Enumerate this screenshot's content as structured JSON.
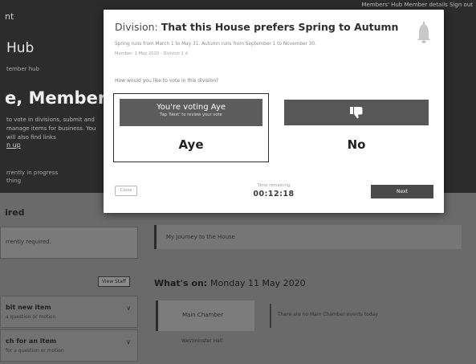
{
  "background": {
    "topbar_label": "nt",
    "topnav_text": "Members' Hub   Member details   Sign out",
    "hub_title": "Hub",
    "hub_sub": "tember hub",
    "welcome_title": "e, Member of P",
    "welcome_desc": "to vote in divisions, submit and manage items for business. You will also find links",
    "signup_link": "n up",
    "progress_text": "rrently in progress\nthing",
    "required_heading": "ired",
    "required_card_text": "rrently required.",
    "view_all_label": "View Staff",
    "list_items": [
      {
        "title": "bit new item",
        "sub": "a question or motion"
      },
      {
        "title": "ch for an item",
        "sub": "for a question or motion"
      }
    ],
    "journey_text": "My Journey to the House",
    "whatson_prefix": "What's on:",
    "whatson_date": "Monday 11 May 2020",
    "chamber_label": "Main Chamber",
    "westminster_label": "Westminster Hall",
    "no_event_text": "There are no Main Chamber events today"
  },
  "modal": {
    "title_prefix": "Division:",
    "title_main": "That this House prefers Spring to Autumn",
    "description": "Spring runs from March 1 to May 31. Autumn runs from September 1 to November 30.",
    "meta": "Member: 1 May 2020 - Division 1 d",
    "question": "How would you like to vote in this division?",
    "aye_banner_main": "You're voting Aye",
    "aye_banner_sub": "Tap 'Next' to review your vote",
    "aye_label": "Aye",
    "no_label": "No",
    "close_label": "Close",
    "timer_label": "Time remaining",
    "timer_value": "00:12:18",
    "next_label": "Next"
  }
}
